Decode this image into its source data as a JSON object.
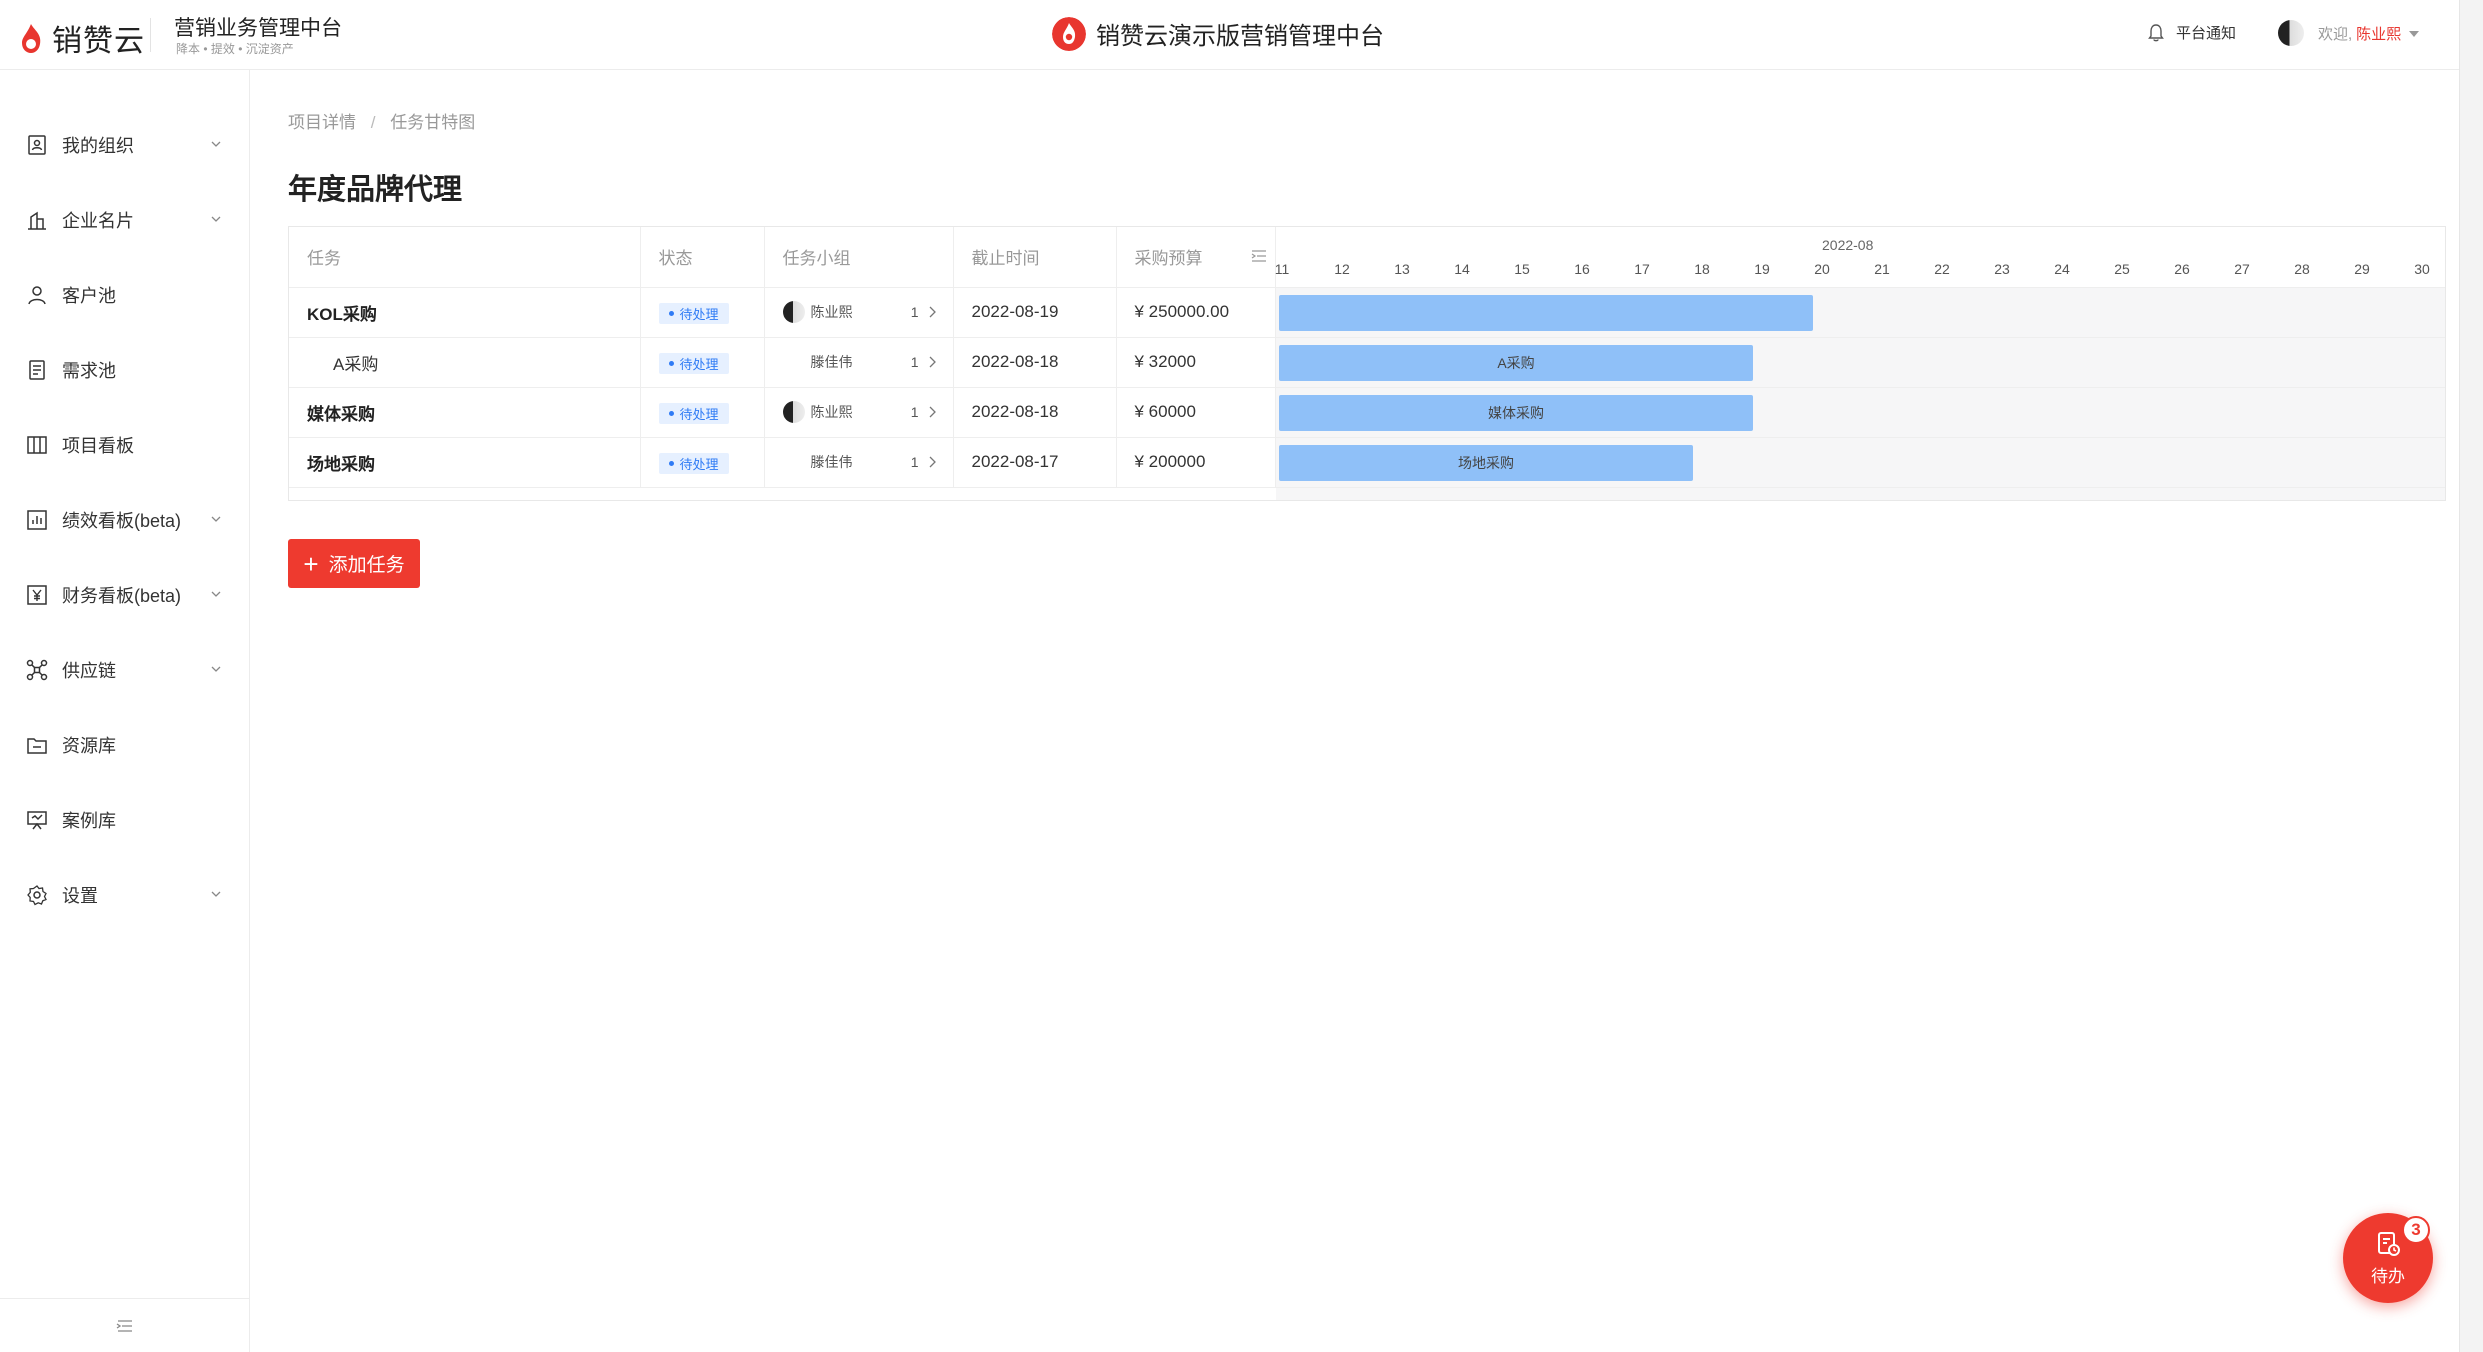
{
  "header": {
    "logo_text": "销赞云",
    "system_title": "营销业务管理中台",
    "system_subtitle": "降本 • 提效 • 沉淀资产",
    "center_title": "销赞云演示版营销管理中台",
    "notify_label": "平台通知",
    "welcome": "欢迎,",
    "username": "陈业熙"
  },
  "sidebar": {
    "items": [
      {
        "label": "我的组织",
        "icon": "org-icon",
        "expandable": true
      },
      {
        "label": "企业名片",
        "icon": "building-icon",
        "expandable": true
      },
      {
        "label": "客户池",
        "icon": "user-icon",
        "expandable": false
      },
      {
        "label": "需求池",
        "icon": "document-icon",
        "expandable": false
      },
      {
        "label": "项目看板",
        "icon": "board-icon",
        "expandable": false
      },
      {
        "label": "绩效看板(beta)",
        "icon": "chart-icon",
        "expandable": true
      },
      {
        "label": "财务看板(beta)",
        "icon": "yen-icon",
        "expandable": true
      },
      {
        "label": "供应链",
        "icon": "network-icon",
        "expandable": true
      },
      {
        "label": "资源库",
        "icon": "folder-icon",
        "expandable": false
      },
      {
        "label": "案例库",
        "icon": "presentation-icon",
        "expandable": false
      },
      {
        "label": "设置",
        "icon": "gear-icon",
        "expandable": true
      }
    ]
  },
  "breadcrumb": {
    "items": [
      "项目详情",
      "任务甘特图"
    ],
    "separator": "/"
  },
  "page_title": "年度品牌代理",
  "table": {
    "headers": [
      "任务",
      "状态",
      "任务小组",
      "截止时间",
      "采购预算"
    ],
    "rows": [
      {
        "task": "KOL采购",
        "bold": true,
        "status": "待处理",
        "member": "陈业熙",
        "has_avatar": true,
        "count": "1",
        "deadline": "2022-08-19",
        "budget": "¥ 250000.00",
        "bar_label": ""
      },
      {
        "task": "A采购",
        "bold": false,
        "status": "待处理",
        "member": "滕佳伟",
        "has_avatar": false,
        "count": "1",
        "deadline": "2022-08-18",
        "budget": "¥ 32000",
        "bar_label": "A采购"
      },
      {
        "task": "媒体采购",
        "bold": true,
        "status": "待处理",
        "member": "陈业熙",
        "has_avatar": true,
        "count": "1",
        "deadline": "2022-08-18",
        "budget": "¥ 60000",
        "bar_label": "媒体采购"
      },
      {
        "task": "场地采购",
        "bold": true,
        "status": "待处理",
        "member": "滕佳伟",
        "has_avatar": false,
        "count": "1",
        "deadline": "2022-08-17",
        "budget": "¥ 200000",
        "bar_label": "场地采购"
      }
    ]
  },
  "timeline": {
    "month_label": "2022-08",
    "days": [
      "11",
      "12",
      "13",
      "14",
      "15",
      "16",
      "17",
      "18",
      "19",
      "20",
      "21",
      "22",
      "23",
      "24",
      "25",
      "26",
      "27",
      "28",
      "29",
      "30"
    ],
    "bars": [
      {
        "start_day": "11",
        "end_day": "19"
      },
      {
        "start_day": "11",
        "end_day": "18"
      },
      {
        "start_day": "11",
        "end_day": "18"
      },
      {
        "start_day": "11",
        "end_day": "17"
      }
    ],
    "bar_color": "#8fc0f8"
  },
  "add_task_label": "添加任务",
  "todo": {
    "label": "待办",
    "count": "3"
  },
  "colors": {
    "accent": "#ee3a2f",
    "status_blue": "#2f7bf5"
  }
}
